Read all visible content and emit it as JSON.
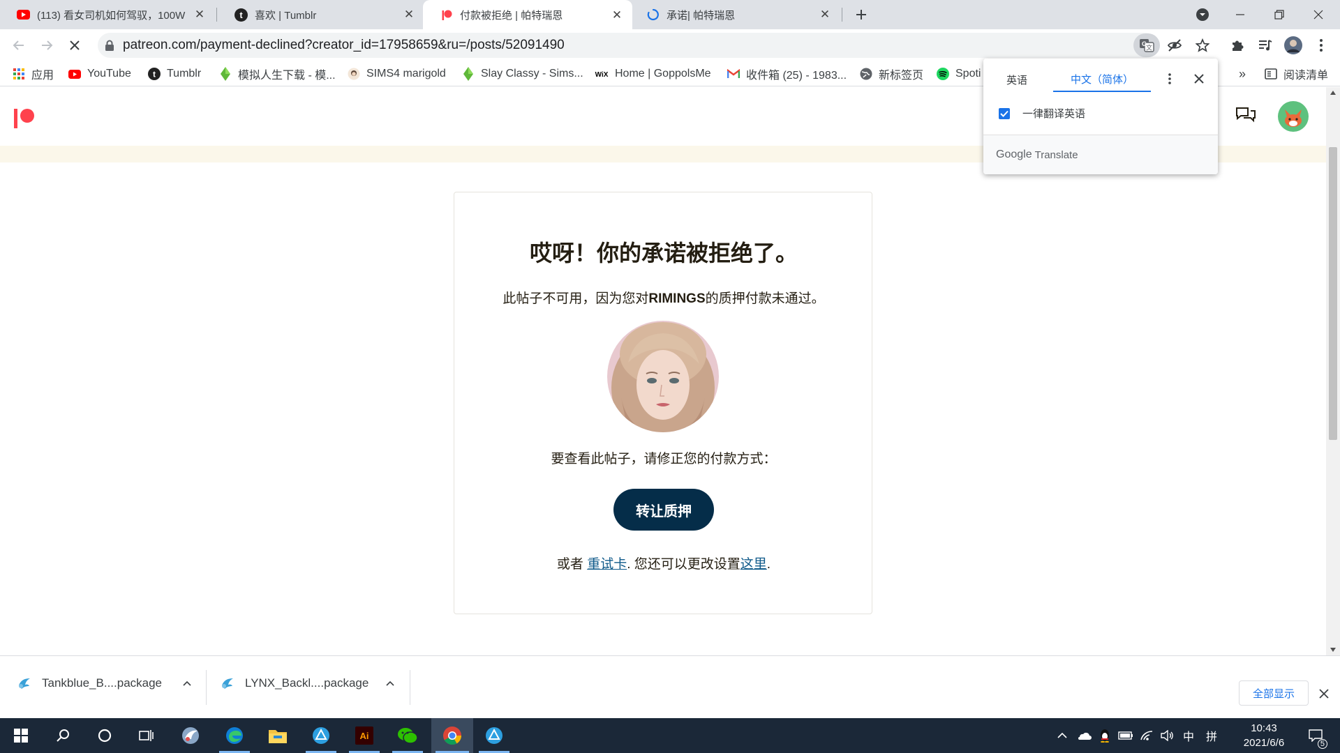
{
  "browser": {
    "tabs": [
      {
        "title": "(113) 看女司机如何驾驭，100W",
        "favicon": "youtube-icon",
        "active": false
      },
      {
        "title": "喜欢 | Tumblr",
        "favicon": "tumblr-icon",
        "active": false
      },
      {
        "title": "付款被拒绝 | 帕特瑞恩",
        "favicon": "patreon-icon",
        "active": true
      },
      {
        "title": "承诺| 帕特瑞恩",
        "favicon": "loading-spinner-icon",
        "active": false
      }
    ],
    "url": "patreon.com/payment-declined?creator_id=17958659&ru=/posts/52091490",
    "bookmarks": [
      {
        "label": "应用",
        "icon": "apps-grid-icon"
      },
      {
        "label": "YouTube",
        "icon": "youtube-icon"
      },
      {
        "label": "Tumblr",
        "icon": "tumblr-icon"
      },
      {
        "label": "模拟人生下载 - 模...",
        "icon": "sims-plumbob-icon"
      },
      {
        "label": "SIMS4 marigold",
        "icon": "marigold-avatar-icon"
      },
      {
        "label": "Slay Classy - Sims...",
        "icon": "sims-plumbob-icon"
      },
      {
        "label": "Home | GoppolsMe",
        "icon": "wix-icon"
      },
      {
        "label": "收件箱 (25) - 1983...",
        "icon": "gmail-icon"
      },
      {
        "label": "新标签页",
        "icon": "globe-icon"
      },
      {
        "label": "Spoti",
        "icon": "spotify-icon"
      }
    ],
    "bookmarks_overflow": "»",
    "reading_list": "阅读清单"
  },
  "translate_popup": {
    "source_lang": "英语",
    "target_lang": "中文（简体）",
    "always_translate_label": "一律翻译英语",
    "always_translate_checked": true,
    "footer_brand": "Google",
    "footer_product": "Translate"
  },
  "page": {
    "title": "哎呀！你的承诺被拒绝了。",
    "message_before": "此帖子不可用，因为您对",
    "creator_name": "RIMINGS",
    "message_after": "的质押付款未通过。",
    "fix_prompt": "要查看此帖子，请修正您的付款方式：",
    "primary_button": "转让质押",
    "or_text": "或者 ",
    "retry_link": "重试卡",
    "settings_text": ". 您还可以更改设置",
    "here_link": "这里",
    "end_period": "."
  },
  "downloads": {
    "items": [
      {
        "name": "Tankblue_B....package"
      },
      {
        "name": "LYNX_Backl....package"
      }
    ],
    "show_all_label": "全部显示"
  },
  "taskbar": {
    "ime_lang": "中",
    "ime_mode": "拼",
    "time": "10:43",
    "date": "2021/6/6",
    "notifications": "5"
  },
  "colors": {
    "patreon_brand": "#ff424d",
    "button_navy": "#052d49",
    "link_blue": "#0f5a8a",
    "chrome_tabstrip": "#dee1e6",
    "taskbar": "#1b2838"
  }
}
